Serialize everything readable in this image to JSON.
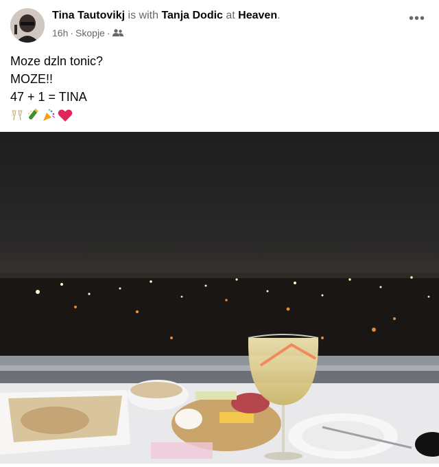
{
  "post": {
    "author": "Tina Tautovikj",
    "with_text": " is with ",
    "tagged": "Tanja Dodic",
    "at_text": " at ",
    "place": "Heaven",
    "period": ".",
    "time": "16h",
    "location": "Skopje",
    "separator": "·",
    "audience_icon": "friends-icon",
    "more_icon": "more-horizontal-icon",
    "more_label": "•••"
  },
  "body": {
    "lines": [
      "Moze dzln tonic?",
      "MOZE!!",
      "47 + 1 = TINA"
    ],
    "emojis": [
      "clinking-glasses-icon",
      "champagne-bottle-icon",
      "party-popper-icon",
      "red-heart-icon"
    ]
  },
  "photo": {
    "description_icon": "night-city-balcony-photo"
  },
  "colors": {
    "text": "#050505",
    "secondary": "#65676b",
    "heart": "#e0245e"
  }
}
